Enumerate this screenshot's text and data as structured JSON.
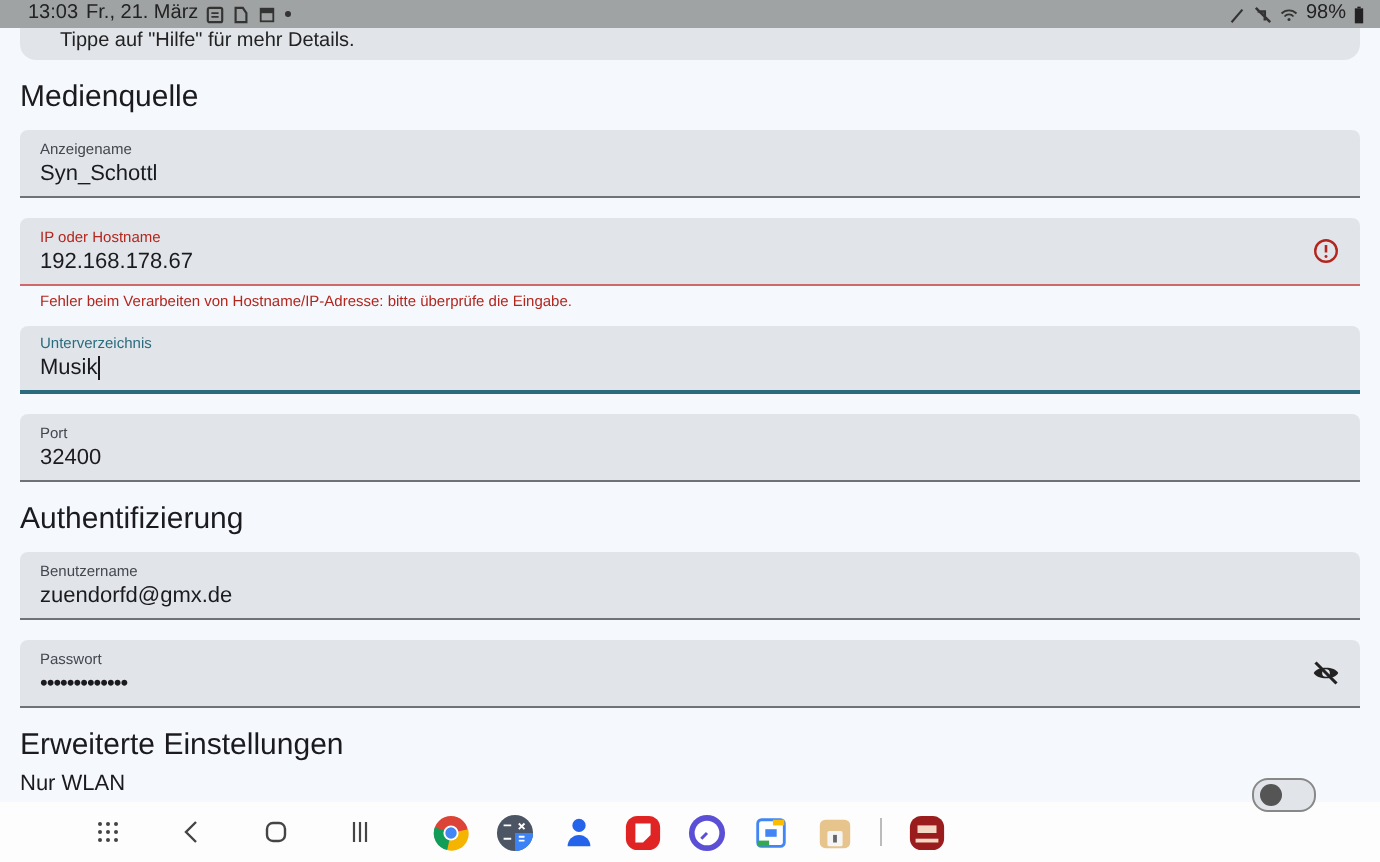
{
  "status_bar": {
    "time": "13:03",
    "date": "Fr., 21. März",
    "battery": "98%"
  },
  "hint": "Tippe auf \"Hilfe\" für mehr Details.",
  "sections": [
    {
      "title": "Medienquelle",
      "fields": [
        {
          "kind": "text",
          "label": "Anzeigename",
          "value": "Syn_Schottl",
          "invalid": false,
          "focused": false
        },
        {
          "kind": "text",
          "label": "IP oder Hostname",
          "value": "192.168.178.67",
          "invalid": true,
          "focused": false,
          "error": "Fehler beim Verarbeiten von Hostname/IP-Adresse: bitte überprüfe die Eingabe."
        },
        {
          "kind": "text",
          "label": "Unterverzeichnis",
          "value": "Musik",
          "invalid": false,
          "focused": true
        },
        {
          "kind": "text",
          "label": "Port",
          "value": "32400",
          "invalid": false,
          "focused": false
        }
      ]
    },
    {
      "title": "Authentifizierung",
      "fields": [
        {
          "kind": "text",
          "label": "Benutzername",
          "value": "zuendorfd@gmx.de",
          "invalid": false,
          "focused": false
        },
        {
          "kind": "password",
          "label": "Passwort",
          "value": "•••••••••••••",
          "invalid": false,
          "focused": false
        }
      ]
    }
  ],
  "advanced": {
    "title": "Erweiterte Einstellungen",
    "switch": {
      "label": "Nur WLAN",
      "on": false
    }
  }
}
